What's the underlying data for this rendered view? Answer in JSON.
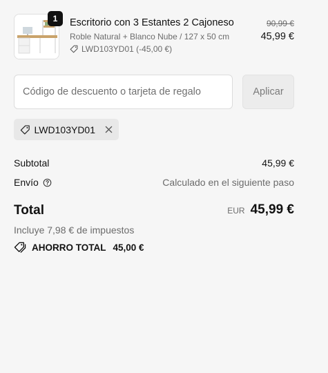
{
  "product": {
    "quantity": "1",
    "title": "Escritorio con 3 Estantes 2 Cajoneso",
    "variant": "Roble Natural + Blanco Nube / 127 x 50 cm",
    "discount_line": "LWD103YD01 (-45,00 €)",
    "original_price": "90,99 €",
    "price": "45,99 €",
    "image_icon": "desk-product-image"
  },
  "discount": {
    "placeholder": "Código de descuento o tarjeta de regalo",
    "value": "",
    "apply_label": "Aplicar"
  },
  "applied_code": {
    "code": "LWD103YD01",
    "icon": "tag-icon",
    "remove_icon": "close-icon"
  },
  "summary": {
    "subtotal_label": "Subtotal",
    "subtotal_value": "45,99 €",
    "shipping_label": "Envío",
    "shipping_value": "Calculado en el siguiente paso",
    "total_label": "Total",
    "currency": "EUR",
    "total_value": "45,99 €",
    "tax_note": "Incluye 7,98 € de impuestos",
    "savings_label": "AHORRO TOTAL",
    "savings_value": "45,00 €"
  },
  "colors": {
    "background": "#f6f6f6",
    "badge": "#111111",
    "muted_text": "#6b6b6b",
    "chip_bg": "#e8e8e8"
  }
}
